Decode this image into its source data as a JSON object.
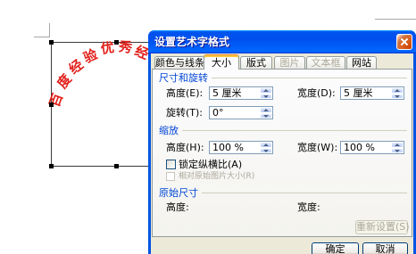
{
  "document": {
    "wordart": {
      "chars": [
        "百",
        "度",
        "经",
        "验",
        "优",
        "秀",
        "经"
      ]
    }
  },
  "dialog": {
    "title": "设置艺术字格式",
    "tabs": [
      {
        "label": "颜色与线条",
        "selected": false,
        "disabled": false
      },
      {
        "label": "大小",
        "selected": true,
        "disabled": false
      },
      {
        "label": "版式",
        "selected": false,
        "disabled": false
      },
      {
        "label": "图片",
        "selected": false,
        "disabled": true
      },
      {
        "label": "文本框",
        "selected": false,
        "disabled": true
      },
      {
        "label": "网站",
        "selected": false,
        "disabled": false
      }
    ],
    "size_rotate": {
      "heading": "尺寸和旋转",
      "height_label": "高度(E):",
      "height_value": "5 厘米",
      "width_label": "宽度(D):",
      "width_value": "5 厘米",
      "rotation_label": "旋转(T):",
      "rotation_value": "0°"
    },
    "scale": {
      "heading": "缩放",
      "height_label": "高度(H):",
      "height_value": "100 %",
      "width_label": "宽度(W):",
      "width_value": "100 %",
      "lock_aspect_label": "锁定纵横比(A)",
      "lock_aspect_checked": false,
      "relative_original_label": "相对原始图片大小(R)",
      "relative_original_checked": false,
      "relative_original_disabled": true
    },
    "original_size": {
      "heading": "原始尺寸",
      "height_label": "高度:",
      "width_label": "宽度:",
      "reset_label": "重新设置(S)",
      "reset_disabled": true
    },
    "buttons": {
      "ok_label": "确定",
      "cancel_label": "取消"
    }
  },
  "icons": {
    "close": "close-icon",
    "spin_up": "spin-up-icon",
    "spin_down": "spin-down-icon",
    "selection_handle": "selection-handle-icon"
  },
  "colors": {
    "titlebar_blue": "#0054E3",
    "dialog_face": "#ECE9D8",
    "wordart_red": "#E2201B",
    "group_heading_blue": "#0046D5",
    "close_button_red": "#DC6527",
    "selected_tab_orange": "#FFC73C",
    "disabled_text": "#ACA899"
  }
}
